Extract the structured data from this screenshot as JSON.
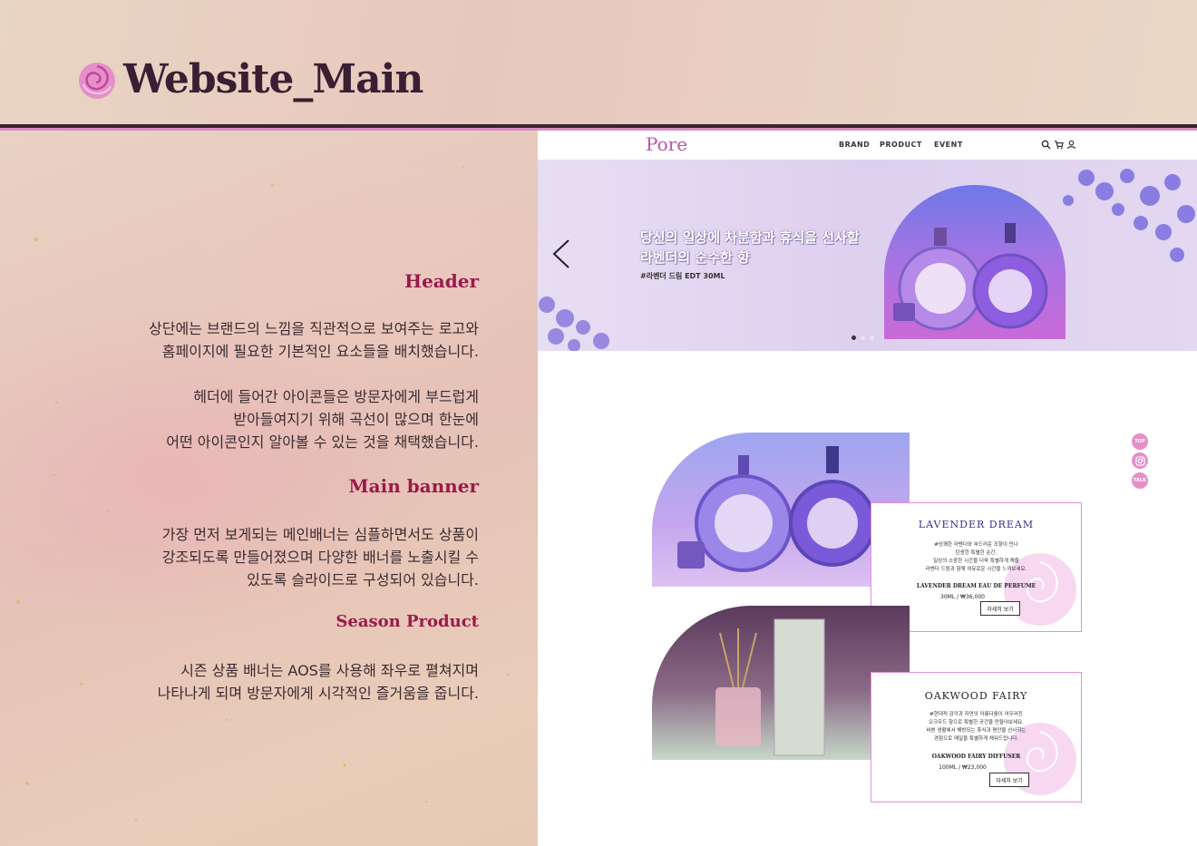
{
  "page": {
    "title": "Website_Main"
  },
  "sections": [
    {
      "heading": "Header",
      "paragraphs": [
        "상단에는 브랜드의 느낌을 직관적으로 보여주는 로고와\n홈페이지에 필요한 기본적인 요소들을 배치했습니다.",
        "헤더에 들어간 아이콘들은 방문자에게 부드럽게\n받아들여지기 위해 곡선이 많으며 한눈에\n어떤 아이콘인지 알아볼 수 있는 것을 채택했습니다."
      ]
    },
    {
      "heading": "Main banner",
      "paragraphs": [
        "가장 먼저 보게되는 메인배너는 심플하면서도 상품이\n강조되도록 만들어졌으며 다양한 배너를 노출시킬 수\n있도록 슬라이드로 구성되어 있습니다."
      ]
    },
    {
      "heading": "Season Product",
      "paragraphs": [
        "시즌 상품 배너는 AOS를 사용해 좌우로 펼쳐지며\n나타나게 되며 방문자에게 시각적인 즐거움을 줍니다."
      ]
    }
  ],
  "site": {
    "logo": "Pore",
    "nav": [
      "BRAND",
      "PRODUCT",
      "EVENT"
    ],
    "icons": [
      "search-icon",
      "cart-icon",
      "user-icon"
    ],
    "banner": {
      "line1": "당신의 일상에 차분함과 휴식을 선사할",
      "line2": "라벤더의 순수한 향",
      "sub": "#라벤더 드림 EDT 30ML",
      "slides": 3,
      "active_slide": 1
    },
    "products": [
      {
        "name": "LAVENDER DREAM",
        "desc": "#상쾌한 라벤더와 부드러운 조향이 만나\n탄생한 특별한 순간.\n일상의 소중한 시간을 더욱 특별하게 해줄\n라벤더 드림과 함께 여유로운 시간을 느껴보세요.",
        "pname": "LAVENDER DREAM EAU DE PERFUME",
        "price": "30ML / ₩36,000",
        "button": "자세히 보기"
      },
      {
        "name": "OAKWOOD FAIRY",
        "desc": "#현대적 감각과 자연의 아름다움이 어우러진\n오크우드 향으로 특별한 공간을 만들어보세요.\n바쁜 생활에서 해방되는 휴식과 평안을 선사하는\n경험으로 매일을 특별하게 채워드립니다.",
        "pname": "OAKWOOD FAIRY DIFFUSER",
        "price": "100ML / ₩23,000",
        "button": "자세히 보기"
      }
    ],
    "floating": {
      "top": "TOP",
      "instagram": "instagram-icon",
      "talk": "TALK"
    }
  },
  "colors": {
    "accent": "#9a1a4a",
    "brand_pink": "#e58fc9",
    "divider": "#3a2230"
  }
}
